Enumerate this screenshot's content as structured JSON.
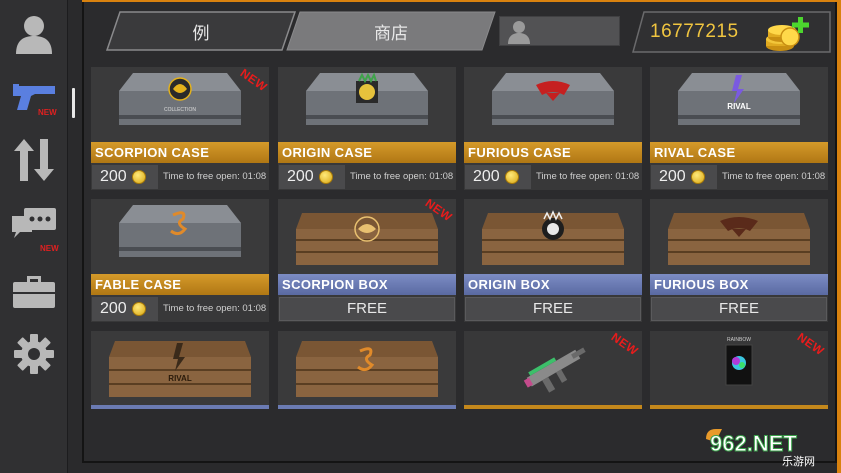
{
  "tabs": [
    {
      "label": "例"
    },
    {
      "label": "商店"
    }
  ],
  "coins": {
    "value": "16777215"
  },
  "sidebar": {
    "items": [
      {
        "icon": "profile-icon"
      },
      {
        "icon": "gun-icon",
        "badge": "NEW"
      },
      {
        "icon": "trade-arrows-icon"
      },
      {
        "icon": "chat-icon",
        "badge": "NEW"
      },
      {
        "icon": "briefcase-icon"
      },
      {
        "icon": "gear-icon"
      }
    ]
  },
  "cases": [
    {
      "name": "SCORPION CASE",
      "price": "200",
      "timer": "Time to free open: 01:08",
      "badge": "NEW",
      "crest_text": "SCORPION"
    },
    {
      "name": "ORIGIN CASE",
      "price": "200",
      "timer": "Time to free open: 01:08"
    },
    {
      "name": "FURIOUS CASE",
      "price": "200",
      "timer": "Time to free open: 01:08"
    },
    {
      "name": "RIVAL CASE",
      "price": "200",
      "timer": "Time to free open: 01:08",
      "crest_text": "RIVAL"
    },
    {
      "name": "FABLE CASE",
      "price": "200",
      "timer": "Time to free open: 01:08"
    }
  ],
  "boxes": [
    {
      "name": "SCORPION BOX",
      "price": "FREE",
      "badge": "NEW"
    },
    {
      "name": "ORIGIN BOX",
      "price": "FREE"
    },
    {
      "name": "FURIOUS BOX",
      "price": "FREE"
    }
  ],
  "bottom_items": [
    {
      "kind": "rival-box",
      "crest_text": "RIVAL"
    },
    {
      "kind": "fable-box"
    },
    {
      "kind": "weapon",
      "badge": "NEW"
    },
    {
      "kind": "rainbow-pack",
      "badge": "NEW",
      "pack_text": "RAINBOW"
    }
  ],
  "case_collection_text": "COLLECTION",
  "watermark": {
    "text": "962.NET",
    "sub": "乐游网"
  },
  "colors": {
    "accent": "#d9820f",
    "gold_label": "#c4881c",
    "blue_label": "#6b7bb3",
    "coin": "#f0c540",
    "new": "#e81c1c"
  }
}
